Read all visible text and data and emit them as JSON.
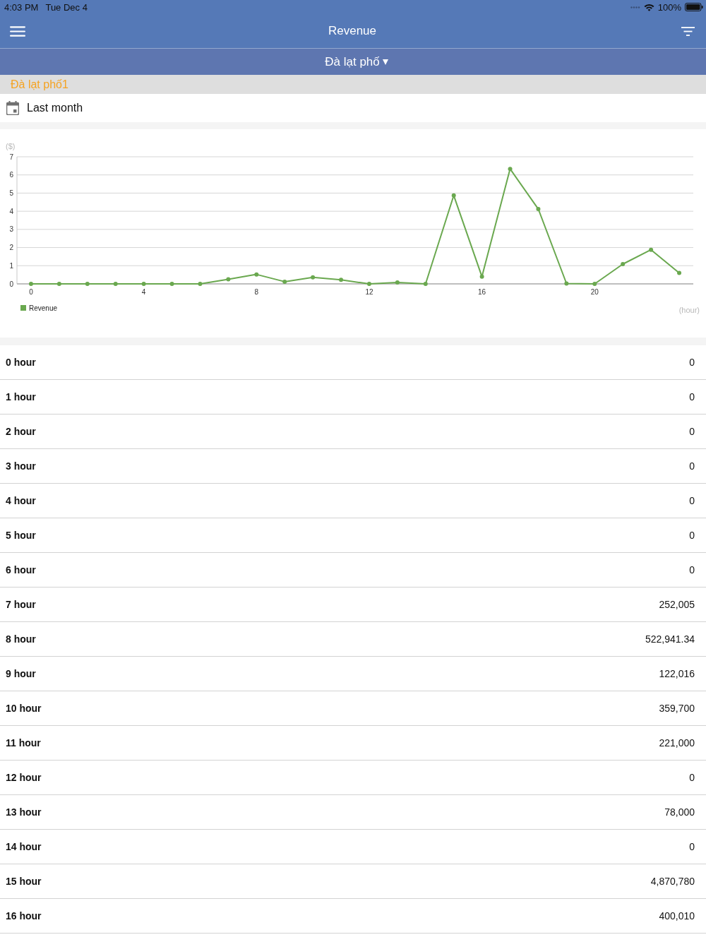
{
  "status_bar": {
    "time": "4:03 PM",
    "date": "Tue Dec 4",
    "battery": "100%"
  },
  "header": {
    "title": "Revenue"
  },
  "store_selector": {
    "label": "Đà lạt phố"
  },
  "branch": {
    "name": "Đà lạt phố1"
  },
  "date_filter": {
    "label": "Last month"
  },
  "chart": {
    "chart_data": {
      "type": "line",
      "xlabel": "(hour)",
      "ylabel": "($)",
      "x": [
        0,
        1,
        2,
        3,
        4,
        5,
        6,
        7,
        8,
        9,
        10,
        11,
        12,
        13,
        14,
        15,
        16,
        17,
        18,
        19,
        20,
        21,
        22,
        23
      ],
      "series": [
        {
          "name": "Revenue",
          "color": "#6aa84f",
          "marker": true,
          "values": [
            0,
            0,
            0,
            0,
            0,
            0,
            0,
            0.25,
            0.52,
            0.12,
            0.36,
            0.22,
            0,
            0.08,
            0,
            4.87,
            0.4,
            6.33,
            4.12,
            0.02,
            0,
            1.09,
            1.88,
            0.6
          ]
        }
      ],
      "xlim": [
        -0.5,
        23.5
      ],
      "ylim": [
        0,
        7
      ],
      "xticks": [
        0,
        4,
        8,
        12,
        16,
        20
      ],
      "yticks": [
        0,
        1,
        2,
        3,
        4,
        5,
        6,
        7
      ],
      "grid": true
    }
  },
  "table": {
    "rows": [
      {
        "label": "0 hour",
        "value": "0"
      },
      {
        "label": "1 hour",
        "value": "0"
      },
      {
        "label": "2 hour",
        "value": "0"
      },
      {
        "label": "3 hour",
        "value": "0"
      },
      {
        "label": "4 hour",
        "value": "0"
      },
      {
        "label": "5 hour",
        "value": "0"
      },
      {
        "label": "6 hour",
        "value": "0"
      },
      {
        "label": "7 hour",
        "value": "252,005"
      },
      {
        "label": "8 hour",
        "value": "522,941.34"
      },
      {
        "label": "9 hour",
        "value": "122,016"
      },
      {
        "label": "10 hour",
        "value": "359,700"
      },
      {
        "label": "11 hour",
        "value": "221,000"
      },
      {
        "label": "12 hour",
        "value": "0"
      },
      {
        "label": "13 hour",
        "value": "78,000"
      },
      {
        "label": "14 hour",
        "value": "0"
      },
      {
        "label": "15 hour",
        "value": "4,870,780"
      },
      {
        "label": "16 hour",
        "value": "400,010"
      }
    ]
  }
}
